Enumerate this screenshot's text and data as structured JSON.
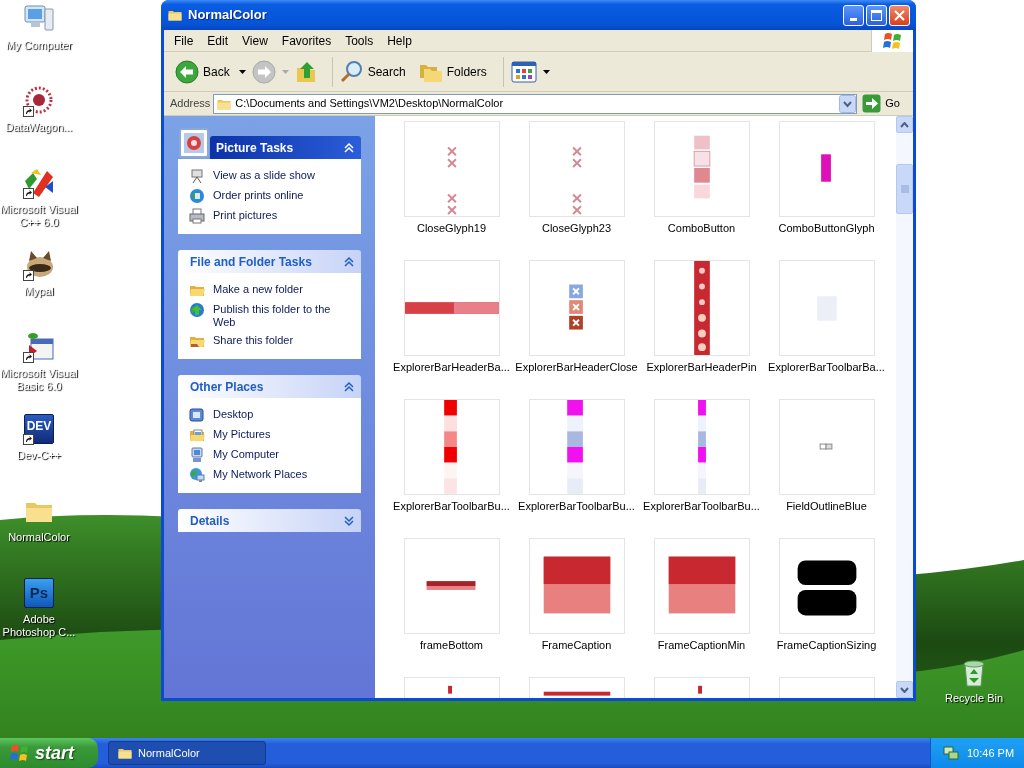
{
  "desktop_icons": [
    {
      "label": "My Computer",
      "kind": "computer",
      "shortcut": false
    },
    {
      "label": "DataWagon...",
      "kind": "datawagon",
      "shortcut": true
    },
    {
      "label": "Microsoft Visual C++ 6.0",
      "kind": "msvc",
      "shortcut": true
    },
    {
      "label": "Mypal",
      "kind": "mypal",
      "shortcut": true
    },
    {
      "label": "Microsoft Visual Basic 6.0",
      "kind": "vb",
      "shortcut": true
    },
    {
      "label": "Dev-C++",
      "kind": "badge",
      "badge_text": "DEV",
      "shortcut": true
    },
    {
      "label": "NormalColor",
      "kind": "folder",
      "shortcut": false
    },
    {
      "label": "Adobe Photoshop C...",
      "kind": "badge",
      "badge_text": "Ps",
      "shortcut": false
    }
  ],
  "window": {
    "title": "NormalColor"
  },
  "menu_bar": [
    "File",
    "Edit",
    "View",
    "Favorites",
    "Tools",
    "Help"
  ],
  "toolbar": [
    {
      "kind": "back",
      "label": "Back",
      "disabled": false,
      "dropdown": true
    },
    {
      "kind": "forward",
      "disabled": true,
      "dropdown": true
    },
    {
      "kind": "up",
      "disabled": false
    },
    {
      "kind": "search",
      "label": "Search",
      "separator_before": true
    },
    {
      "kind": "folders",
      "label": "Folders"
    },
    {
      "kind": "views",
      "dropdown": true,
      "separator_before": true
    }
  ],
  "address_bar": {
    "label": "Address",
    "value": "C:\\Documents and Settings\\VM2\\Desktop\\NormalColor",
    "go": "Go"
  },
  "task_panes": [
    {
      "title": "Picture Tasks",
      "kind": "special",
      "expanded": true,
      "items": [
        {
          "label": "View as a slide show",
          "kind": "slideshow"
        },
        {
          "label": "Order prints online",
          "kind": "globe"
        },
        {
          "label": "Print pictures",
          "kind": "printer"
        }
      ]
    },
    {
      "title": "File and Folder Tasks",
      "kind": "normal",
      "expanded": true,
      "items": [
        {
          "label": "Make a new folder",
          "kind": "folder"
        },
        {
          "label": "Publish this folder to the Web",
          "kind": "publish"
        },
        {
          "label": "Share this folder",
          "kind": "share"
        }
      ]
    },
    {
      "title": "Other Places",
      "kind": "normal",
      "expanded": true,
      "items": [
        {
          "label": "Desktop",
          "kind": "desktop"
        },
        {
          "label": "My Pictures",
          "kind": "pictures"
        },
        {
          "label": "My Computer",
          "kind": "computer"
        },
        {
          "label": "My Network Places",
          "kind": "network"
        }
      ]
    },
    {
      "title": "Details",
      "kind": "normal",
      "expanded": false
    }
  ],
  "files": [
    {
      "name": "CloseGlyph19",
      "kind": "crosses"
    },
    {
      "name": "CloseGlyph23",
      "kind": "crosses"
    },
    {
      "name": "ComboButton",
      "kind": "combo"
    },
    {
      "name": "ComboButtonGlyph",
      "kind": "combo-glyph"
    },
    {
      "name": "ExplorerBarHeaderBa...",
      "kind": "header-bar"
    },
    {
      "name": "ExplorerBarHeaderClose",
      "kind": "header-close"
    },
    {
      "name": "ExplorerBarHeaderPin",
      "kind": "header-pin"
    },
    {
      "name": "ExplorerBarToolbarBa...",
      "kind": "pale-square"
    },
    {
      "name": "ExplorerBarToolbarBu...",
      "kind": "strip-red"
    },
    {
      "name": "ExplorerBarToolbarBu...",
      "kind": "strip-magenta"
    },
    {
      "name": "ExplorerBarToolbarBu...",
      "kind": "strip-thin"
    },
    {
      "name": "FieldOutlineBlue",
      "kind": "field-outline"
    },
    {
      "name": "frameBottom",
      "kind": "frame-bottom"
    },
    {
      "name": "FrameCaption",
      "kind": "frame-caption"
    },
    {
      "name": "FrameCaptionMin",
      "kind": "frame-caption"
    },
    {
      "name": "FrameCaptionSizing",
      "kind": "frame-sizing"
    },
    {
      "kind": "thin-mark"
    },
    {
      "kind": "bar-mark"
    },
    {
      "kind": "thin-mark"
    },
    {
      "kind": "blank"
    }
  ],
  "recycle_bin": {
    "label": "Recycle Bin"
  },
  "taskbar": {
    "start": "start",
    "tasks": [
      {
        "label": "NormalColor",
        "selected": true
      }
    ],
    "clock": "10:46 PM"
  }
}
